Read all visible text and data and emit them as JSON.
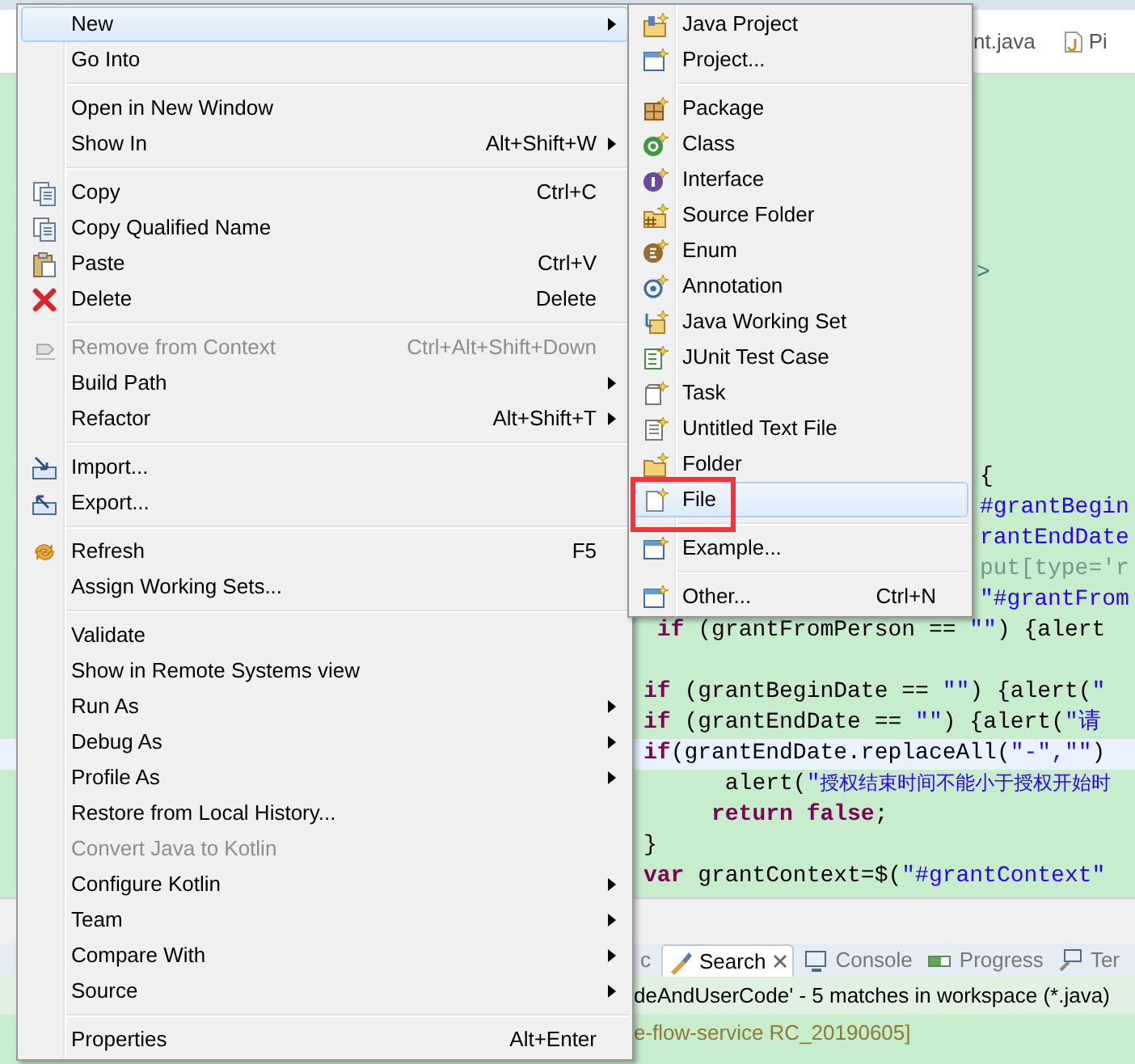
{
  "editor_tabs": [
    {
      "label": "nt.java"
    },
    {
      "label": "Pi"
    }
  ],
  "markup_fragment": ">",
  "code_lines": [
    {
      "kind": "clipped",
      "tokens": [
        {
          "kind": "plain",
          "text": "{"
        }
      ]
    },
    {
      "kind": "clipped",
      "tokens": [
        {
          "kind": "string",
          "text": "#grantBegin"
        }
      ]
    },
    {
      "kind": "clipped",
      "tokens": [
        {
          "kind": "string",
          "text": "rantEndDate"
        }
      ]
    },
    {
      "kind": "clipped",
      "tokens": [
        {
          "kind": "faded",
          "text": "put[type='r"
        }
      ]
    },
    {
      "kind": "clipped",
      "tokens": [
        {
          "kind": "string",
          "text": "\"#grantFrom"
        }
      ]
    },
    {
      "kind": "full",
      "current": false,
      "tokens": [
        {
          "kind": "keyword",
          "text": " if"
        },
        {
          "kind": "plain",
          "text": " (grantFromPerson == "
        },
        {
          "kind": "string",
          "text": "\"\""
        },
        {
          "kind": "plain",
          "text": ") {alert"
        }
      ]
    },
    {
      "kind": "blank"
    },
    {
      "kind": "full",
      "current": false,
      "tokens": [
        {
          "kind": "keyword",
          "text": "if"
        },
        {
          "kind": "plain",
          "text": " (grantBeginDate == "
        },
        {
          "kind": "string",
          "text": "\"\""
        },
        {
          "kind": "plain",
          "text": ") {alert("
        },
        {
          "kind": "string",
          "text": "\""
        }
      ]
    },
    {
      "kind": "full",
      "current": false,
      "tokens": [
        {
          "kind": "keyword",
          "text": "if"
        },
        {
          "kind": "plain",
          "text": " (grantEndDate == "
        },
        {
          "kind": "string",
          "text": "\"\""
        },
        {
          "kind": "plain",
          "text": ") {alert("
        },
        {
          "kind": "string",
          "text": "\"请"
        }
      ]
    },
    {
      "kind": "full",
      "current": true,
      "tokens": [
        {
          "kind": "keyword",
          "text": "if"
        },
        {
          "kind": "plain",
          "text": "(grantEndDate.replaceAll("
        },
        {
          "kind": "string",
          "text": "\"-\",\"\""
        },
        {
          "kind": "plain",
          "text": ")"
        }
      ]
    },
    {
      "kind": "full",
      "current": false,
      "tokens": [
        {
          "kind": "plain",
          "text": "      alert("
        },
        {
          "kind": "string",
          "text": "\""
        },
        {
          "kind": "cjk",
          "text": "授权结束时间不能小于授权开始时"
        }
      ]
    },
    {
      "kind": "full",
      "current": false,
      "tokens": [
        {
          "kind": "keyword",
          "text": "     return false"
        },
        {
          "kind": "plain",
          "text": ";"
        }
      ]
    },
    {
      "kind": "full",
      "current": false,
      "tokens": [
        {
          "kind": "plain",
          "text": "}"
        }
      ]
    },
    {
      "kind": "full",
      "current": false,
      "tokens": [
        {
          "kind": "keyword",
          "text": "var"
        },
        {
          "kind": "plain",
          "text": " grantContext=$("
        },
        {
          "kind": "string",
          "text": "\"#grantContext\""
        }
      ]
    }
  ],
  "context_menu": {
    "items": [
      {
        "kind": "item",
        "label": "New",
        "submenu": true,
        "selected": true,
        "disabled": false
      },
      {
        "kind": "item",
        "label": "Go Into",
        "submenu": false,
        "selected": false,
        "disabled": false
      },
      {
        "kind": "separator"
      },
      {
        "kind": "item",
        "label": "Open in New Window",
        "submenu": false,
        "selected": false,
        "disabled": false
      },
      {
        "kind": "item",
        "label": "Show In",
        "shortcut": "Alt+Shift+W",
        "submenu": true,
        "selected": false,
        "disabled": false
      },
      {
        "kind": "separator"
      },
      {
        "kind": "item",
        "label": "Copy",
        "shortcut": "Ctrl+C",
        "submenu": false,
        "selected": false,
        "disabled": false
      },
      {
        "kind": "item",
        "label": "Copy Qualified Name",
        "submenu": false,
        "selected": false,
        "disabled": false
      },
      {
        "kind": "item",
        "label": "Paste",
        "shortcut": "Ctrl+V",
        "submenu": false,
        "selected": false,
        "disabled": false
      },
      {
        "kind": "item",
        "label": "Delete",
        "shortcut": "Delete",
        "submenu": false,
        "selected": false,
        "disabled": false
      },
      {
        "kind": "separator"
      },
      {
        "kind": "item",
        "label": "Remove from Context",
        "shortcut": "Ctrl+Alt+Shift+Down",
        "submenu": false,
        "selected": false,
        "disabled": true
      },
      {
        "kind": "item",
        "label": "Build Path",
        "submenu": true,
        "selected": false,
        "disabled": false
      },
      {
        "kind": "item",
        "label": "Refactor",
        "shortcut": "Alt+Shift+T",
        "submenu": true,
        "selected": false,
        "disabled": false
      },
      {
        "kind": "separator"
      },
      {
        "kind": "item",
        "label": "Import...",
        "submenu": false,
        "selected": false,
        "disabled": false
      },
      {
        "kind": "item",
        "label": "Export...",
        "submenu": false,
        "selected": false,
        "disabled": false
      },
      {
        "kind": "separator"
      },
      {
        "kind": "item",
        "label": "Refresh",
        "shortcut": "F5",
        "submenu": false,
        "selected": false,
        "disabled": false
      },
      {
        "kind": "item",
        "label": "Assign Working Sets...",
        "submenu": false,
        "selected": false,
        "disabled": false
      },
      {
        "kind": "separator"
      },
      {
        "kind": "item",
        "label": "Validate",
        "submenu": false,
        "selected": false,
        "disabled": false
      },
      {
        "kind": "item",
        "label": "Show in Remote Systems view",
        "submenu": false,
        "selected": false,
        "disabled": false
      },
      {
        "kind": "item",
        "label": "Run As",
        "submenu": true,
        "selected": false,
        "disabled": false
      },
      {
        "kind": "item",
        "label": "Debug As",
        "submenu": true,
        "selected": false,
        "disabled": false
      },
      {
        "kind": "item",
        "label": "Profile As",
        "submenu": true,
        "selected": false,
        "disabled": false
      },
      {
        "kind": "item",
        "label": "Restore from Local History...",
        "submenu": false,
        "selected": false,
        "disabled": false
      },
      {
        "kind": "item",
        "label": "Convert Java to Kotlin",
        "submenu": false,
        "selected": false,
        "disabled": true
      },
      {
        "kind": "item",
        "label": "Configure Kotlin",
        "submenu": true,
        "selected": false,
        "disabled": false
      },
      {
        "kind": "item",
        "label": "Team",
        "submenu": true,
        "selected": false,
        "disabled": false
      },
      {
        "kind": "item",
        "label": "Compare With",
        "submenu": true,
        "selected": false,
        "disabled": false
      },
      {
        "kind": "item",
        "label": "Source",
        "submenu": true,
        "selected": false,
        "disabled": false
      },
      {
        "kind": "separator"
      },
      {
        "kind": "item",
        "label": "Properties",
        "shortcut": "Alt+Enter",
        "submenu": false,
        "selected": false,
        "disabled": false
      }
    ]
  },
  "submenu": {
    "items": [
      {
        "kind": "item",
        "label": "Java Project",
        "selected": false
      },
      {
        "kind": "item",
        "label": "Project...",
        "selected": false
      },
      {
        "kind": "separator"
      },
      {
        "kind": "item",
        "label": "Package",
        "selected": false
      },
      {
        "kind": "item",
        "label": "Class",
        "selected": false
      },
      {
        "kind": "item",
        "label": "Interface",
        "selected": false
      },
      {
        "kind": "item",
        "label": "Source Folder",
        "selected": false
      },
      {
        "kind": "item",
        "label": "Enum",
        "selected": false
      },
      {
        "kind": "item",
        "label": "Annotation",
        "selected": false
      },
      {
        "kind": "item",
        "label": "Java Working Set",
        "selected": false
      },
      {
        "kind": "item",
        "label": "JUnit Test Case",
        "selected": false
      },
      {
        "kind": "item",
        "label": "Task",
        "selected": false
      },
      {
        "kind": "item",
        "label": "Untitled Text File",
        "selected": false
      },
      {
        "kind": "item",
        "label": "Folder",
        "selected": false
      },
      {
        "kind": "item",
        "label": "File",
        "selected": true,
        "annotated": true
      },
      {
        "kind": "separator"
      },
      {
        "kind": "item",
        "label": "Example...",
        "selected": false
      },
      {
        "kind": "separator"
      },
      {
        "kind": "item",
        "label": "Other...",
        "shortcut": "Ctrl+N",
        "selected": false
      }
    ]
  },
  "bottom_panel": {
    "tabs": [
      {
        "label": "c",
        "selected": false,
        "closable": false
      },
      {
        "label": "Search",
        "selected": true,
        "closable": true
      },
      {
        "label": "Console",
        "selected": false,
        "closable": false
      },
      {
        "label": "Progress",
        "selected": false,
        "closable": false
      },
      {
        "label": "Ter",
        "selected": false,
        "closable": false
      }
    ],
    "result_text": "deAndUserCode' - 5 matches in workspace (*.java)",
    "status_text": "e-flow-service RC_20190605]"
  }
}
